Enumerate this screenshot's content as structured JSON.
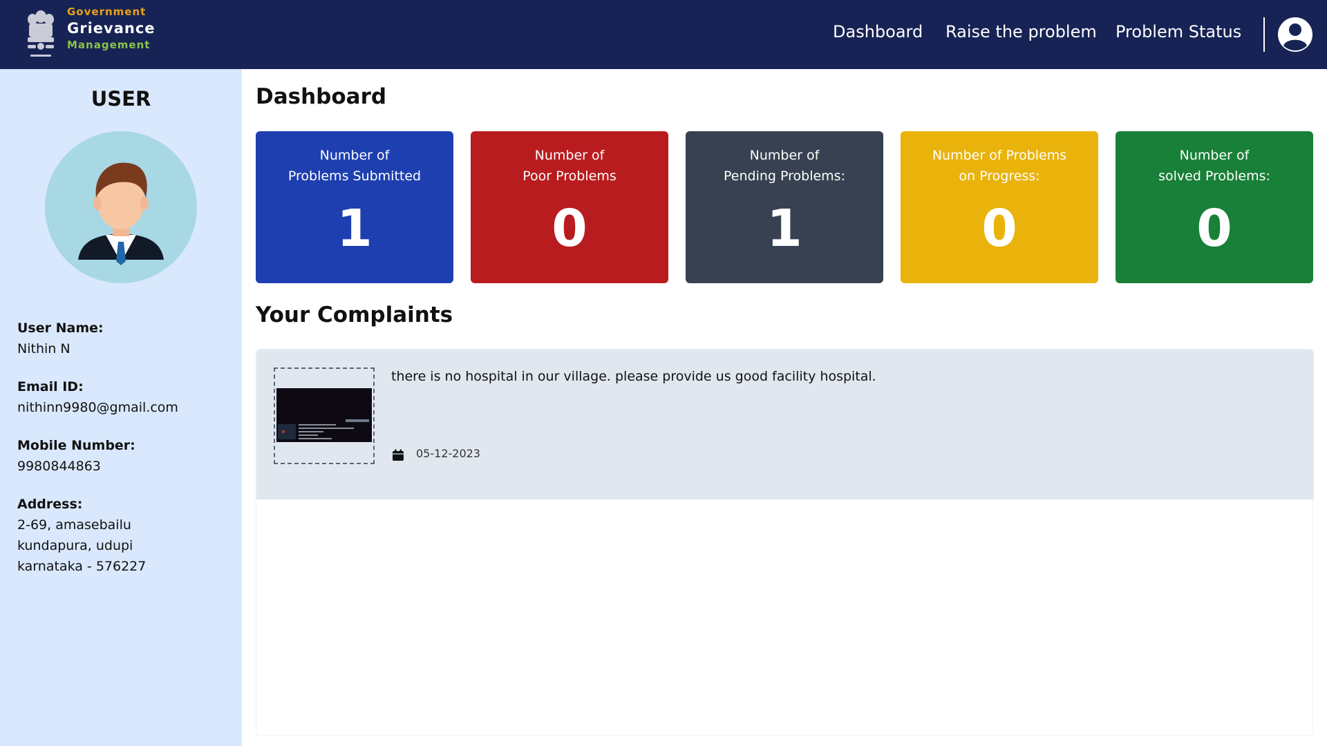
{
  "header": {
    "brand": {
      "line1": "Government",
      "line2": "Grievance",
      "line3": "Management"
    },
    "nav": [
      {
        "label": "Dashboard"
      },
      {
        "label": "Raise the problem"
      },
      {
        "label": "Problem Status"
      }
    ],
    "profile_icon": "user-circle-icon"
  },
  "sidebar": {
    "title": "USER",
    "avatar_icon": "user-avatar",
    "user_name_label": "User Name:",
    "user_name": "Nithin N",
    "email_label": "Email ID:",
    "email": "nithinn9980@gmail.com",
    "mobile_label": "Mobile Number:",
    "mobile": "9980844863",
    "address_label": "Address:",
    "address_lines": [
      "2-69, amasebailu",
      "kundapura, udupi",
      "karnataka - 576227"
    ]
  },
  "main": {
    "title": "Dashboard",
    "cards": [
      {
        "line1": "Number of",
        "line2": "Problems Submitted",
        "value": "1",
        "color": "#1e3fb0"
      },
      {
        "line1": "Number of",
        "line2": "Poor Problems",
        "value": "0",
        "color": "#b91c1f"
      },
      {
        "line1": "Number of",
        "line2": "Pending Problems:",
        "value": "1",
        "color": "#374151"
      },
      {
        "line1": "Number of Problems",
        "line2": "on Progress:",
        "value": "0",
        "color": "#e9b30c"
      },
      {
        "line1": "Number of",
        "line2": "solved Problems:",
        "value": "0",
        "color": "#188038"
      }
    ],
    "complaints_title": "Your Complaints",
    "complaints": [
      {
        "text": "there is no hospital in our village. please provide us good facility hospital.",
        "date": "05-12-2023",
        "date_icon": "calendar-icon"
      }
    ]
  }
}
